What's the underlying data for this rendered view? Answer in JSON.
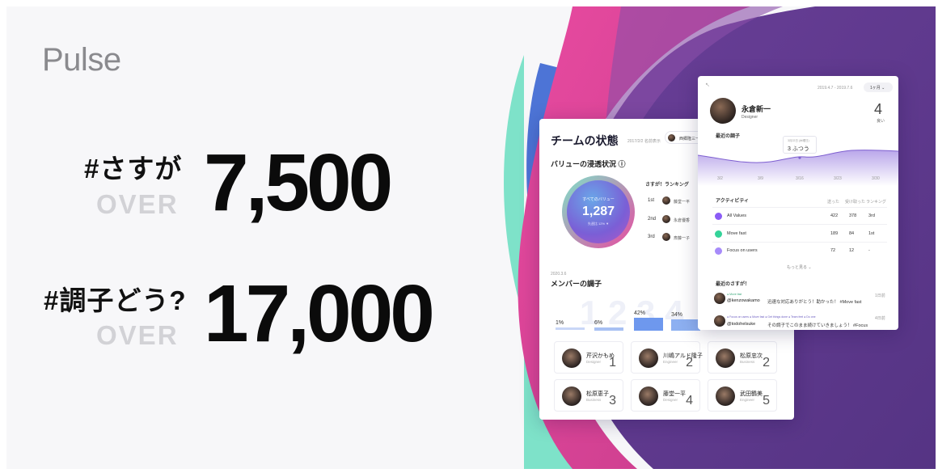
{
  "brand": {
    "logo": "Pulse"
  },
  "stats": [
    {
      "tag": "#さすが",
      "over": "OVER",
      "value": "7,500"
    },
    {
      "tag": "#調子どう?",
      "over": "OVER",
      "value": "17,000"
    }
  ],
  "team_card": {
    "title": "チームの状態",
    "subtitle": "2017/2/2 名前表示",
    "user_chip": "西郷隆三一",
    "section_value": "バリューの浸透状況 ⓘ",
    "circle": {
      "label": "すべてのバリュー",
      "value": "1,287",
      "sub": "先週比 12% ▼"
    },
    "ranking_title": "さすが！ランキング",
    "ranking": [
      {
        "rank": "1st",
        "name": "藤堂一平"
      },
      {
        "rank": "2nd",
        "name": "永倉優香"
      },
      {
        "rank": "3rd",
        "name": "斎藤一子"
      }
    ],
    "date_small": "2020.3.6",
    "member_title": "メンバーの調子",
    "percents": [
      "1%",
      "6%",
      "42%",
      "34%"
    ],
    "members": [
      {
        "name": "芹沢かもめ",
        "role": "Designer",
        "score": "1"
      },
      {
        "name": "川嶋アルド隆子",
        "role": "Engineer",
        "score": "2"
      },
      {
        "name": "松原忠次",
        "role": "Business",
        "score": "2"
      },
      {
        "name": "松原恵子",
        "role": "Business",
        "score": "3"
      },
      {
        "name": "藤堂一平",
        "role": "Designer",
        "score": "4"
      },
      {
        "name": "武田鶴美",
        "role": "Engineer",
        "score": "5"
      }
    ]
  },
  "profile_card": {
    "range": "2019.4.7 - 2019.7.6",
    "period": "1ヶ月 ⌄",
    "name": "永倉新一",
    "role": "Designer",
    "score": "4",
    "score_label": "良い",
    "chart_title": "最近の調子",
    "tooltip_date": "3月22日 (木曜日)",
    "tooltip_value": "3 ふつう",
    "x_ticks": [
      "3/2",
      "3/9",
      "3/16",
      "3/23",
      "3/30"
    ],
    "activity_title": "アクティビティ",
    "activity_headers": [
      "送った",
      "受け取った",
      "ランキング"
    ],
    "activities": [
      {
        "name": "All Values",
        "sent": "422",
        "received": "378",
        "rank": "3rd",
        "color": "#8b5cf6"
      },
      {
        "name": "Move fast",
        "sent": "189",
        "received": "84",
        "rank": "1st",
        "color": "#34d399"
      },
      {
        "name": "Focus on users",
        "sent": "72",
        "received": "12",
        "rank": "-",
        "color": "#a78bfa"
      }
    ],
    "more": "もっと見る ⌄",
    "praise_title": "最近のさすが！",
    "praises": [
      {
        "tag": "● Move fast",
        "user": "@kenzowakamo",
        "text": "迅速な対応ありがとう！助かった！ #Move fast",
        "time": "1日前"
      },
      {
        "tag": "● Focus on users ● Move fast ● Get things done ● Team feel ● Do one",
        "user": "@todohelsuke",
        "text": "その調子でこのまま続けていきましょう！ #Focus",
        "time": "4日前"
      }
    ]
  },
  "colors": {
    "purple": "#5f3b8f",
    "pink": "#e8479a",
    "teal": "#7fe0c8",
    "blue": "#4a6fd8"
  }
}
